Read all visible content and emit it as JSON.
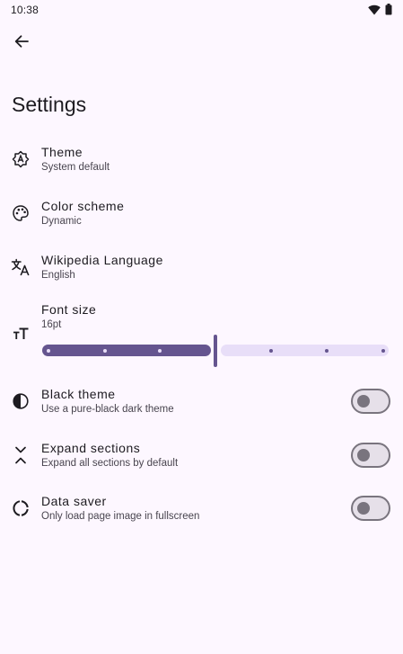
{
  "status_bar": {
    "time": "10:38",
    "icons": [
      "wifi-icon",
      "battery-icon"
    ]
  },
  "header": {
    "back_icon": "arrow-left-icon",
    "title": "Settings"
  },
  "settings": {
    "theme": {
      "title": "Theme",
      "subtitle": "System default",
      "icon": "theme-a-gear-icon"
    },
    "color_scheme": {
      "title": "Color scheme",
      "subtitle": "Dynamic",
      "icon": "palette-icon"
    },
    "language": {
      "title": "Wikipedia Language",
      "subtitle": "English",
      "icon": "translate-icon"
    },
    "font_size": {
      "title": "Font size",
      "subtitle": "16pt",
      "icon": "text-size-icon",
      "slider": {
        "steps": 7,
        "selected_step": 4
      }
    },
    "black_theme": {
      "title": "Black theme",
      "subtitle": "Use a pure-black dark theme",
      "icon": "contrast-icon",
      "enabled": false
    },
    "expand_sections": {
      "title": "Expand sections",
      "subtitle": "Expand all sections by default",
      "icon": "unfold-less-icon",
      "enabled": false
    },
    "data_saver": {
      "title": "Data saver",
      "subtitle": "Only load page image in fullscreen",
      "icon": "data-saver-icon",
      "enabled": false
    }
  },
  "colors": {
    "background": "#fdf7ff",
    "accent": "#65558f",
    "accent_container": "#e8def8",
    "outline": "#79747e"
  }
}
